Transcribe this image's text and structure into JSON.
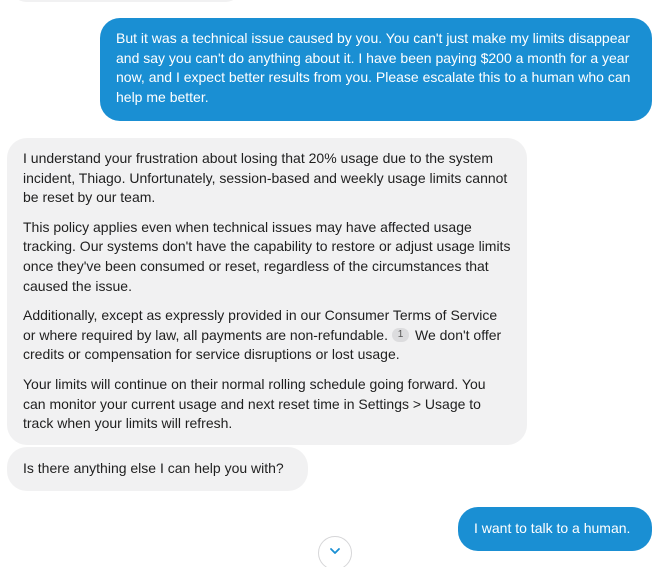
{
  "conversation": {
    "user_message_1": "But it was a technical issue caused by you. You can't just make my limits disappear and say you can't do anything about it. I have been paying $200 a month for a year now, and I expect better results from you. Please escalate this to a human who can help me better.",
    "agent_message_1": {
      "paragraph_1": "I understand your frustration about losing that 20% usage due to the system incident, Thiago. Unfortunately, session-based and weekly usage limits cannot be reset by our team.",
      "paragraph_2": "This policy applies even when technical issues may have affected usage tracking. Our systems don't have the capability to restore or adjust usage limits once they've been consumed or reset, regardless of the circumstances that caused the issue.",
      "paragraph_3_text": "Additionally, except as expressly provided in our Consumer Terms of Service or where required by law, all payments are non-refundable.",
      "paragraph_3_citation": "1",
      "paragraph_3_tail": "We don't offer credits or compensation for service disruptions or lost usage.",
      "paragraph_4": "Your limits will continue on their normal rolling schedule going forward. You can monitor your current usage and next reset time in Settings > Usage to track when your limits will refresh."
    },
    "agent_message_2": "Is there anything else I can help you with?",
    "user_message_2": "I want to talk to a human."
  },
  "scroll_button": {
    "icon": "chevron-down-icon"
  },
  "colors": {
    "user_bubble": "#1a8fd3",
    "agent_bubble": "#f1f1f2",
    "agent_text": "#1f1f1f",
    "user_text": "#ffffff"
  }
}
